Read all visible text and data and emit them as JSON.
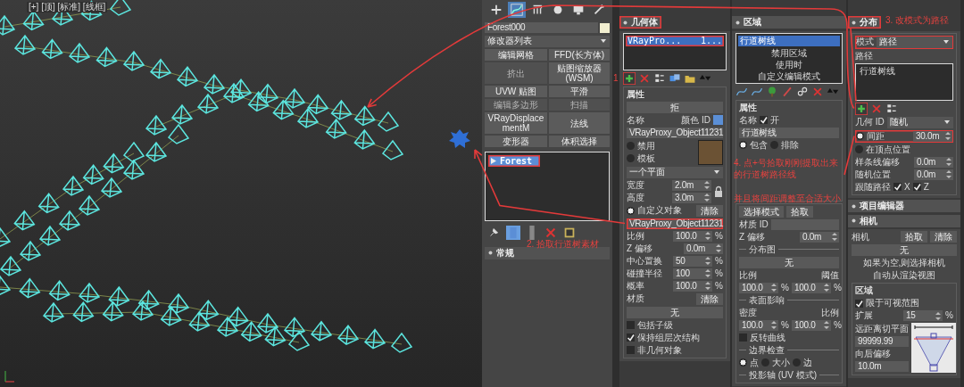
{
  "viewport": {
    "label": "[+] [顶] [标准] [线框]"
  },
  "command_panel": {
    "tabs": [
      {
        "kind": "create",
        "selected": false
      },
      {
        "kind": "modify",
        "selected": true
      },
      {
        "kind": "hierarchy",
        "selected": false
      },
      {
        "kind": "motion",
        "selected": false
      },
      {
        "kind": "display",
        "selected": false
      },
      {
        "kind": "utilities",
        "selected": false
      }
    ],
    "object_name": "Forest000",
    "modifier_list": "修改器列表",
    "modifier_buttons": [
      {
        "label": "编辑网格",
        "disabled": false
      },
      {
        "label": "FFD(长方体)",
        "disabled": false
      },
      {
        "label": "挤出",
        "disabled": true
      },
      {
        "label": "贴图缩放器 (WSM)",
        "disabled": false
      },
      {
        "label": "UVW 贴图",
        "disabled": false
      },
      {
        "label": "平滑",
        "disabled": false
      },
      {
        "label": "编辑多边形",
        "disabled": true
      },
      {
        "label": "扫描",
        "disabled": true
      },
      {
        "label": "VRayDisplacementM",
        "disabled": false
      },
      {
        "label": "法线",
        "disabled": false
      },
      {
        "label": "变形器",
        "disabled": false
      },
      {
        "label": "体积选择",
        "disabled": false
      }
    ],
    "stack": [
      {
        "label": "Forest",
        "selected": true,
        "highlighted": true
      }
    ],
    "stack_tools": [
      {
        "kind": "pin",
        "selected": false
      },
      {
        "kind": "show-result",
        "selected": true
      },
      {
        "kind": "unique",
        "selected": false
      },
      {
        "kind": "remove",
        "selected": false
      },
      {
        "kind": "configure",
        "selected": false
      }
    ],
    "rollouts": [
      {
        "title": "常规"
      }
    ]
  },
  "panels": [
    {
      "rollouts": [
        {
          "title": "几何体",
          "highlighted": true,
          "sections": [
            {
              "boxed": false,
              "rows": [
                {
                  "items": [
                    {
                      "kind": "list",
                      "items": [
                        {
                          "label": "VRayPro...",
                          "detail": "1...",
                          "selected": true,
                          "highlighted": true
                        }
                      ]
                    }
                  ]
                },
                {
                  "items": [
                    {
                      "kind": "toolbar",
                      "icons": [
                        {
                          "kind": "add",
                          "highlighted": true
                        },
                        {
                          "kind": "remove",
                          "highlighted": false
                        },
                        {
                          "kind": "list",
                          "highlighted": false
                        },
                        {
                          "kind": "copy",
                          "highlighted": false
                        },
                        {
                          "kind": "folder",
                          "highlighted": false
                        },
                        {
                          "kind": "arrows",
                          "highlighted": false
                        }
                      ]
                    }
                  ]
                }
              ]
            },
            {
              "boxed": true,
              "title": "属性",
              "rows": [
                {
                  "items": [
                    {
                      "kind": "btn",
                      "text": "拒"
                    }
                  ]
                },
                {
                  "items": [
                    {
                      "kind": "text",
                      "text": "名称"
                    },
                    {
                      "kind": "text",
                      "text": "颜色 ID"
                    },
                    {
                      "kind": "swatch",
                      "color": "#5b8fd6"
                    }
                  ]
                },
                {
                  "items": [
                    {
                      "kind": "field",
                      "value": "VRayProxy_Object11231"
                    }
                  ]
                },
                {
                  "items": [
                    {
                      "kind": "col",
                      "rows": [
                        {
                          "items": [
                            {
                              "kind": "radio",
                              "text": "禁用",
                              "selected": false
                            }
                          ]
                        },
                        {
                          "items": [
                            {
                              "kind": "radio",
                              "text": "模板",
                              "selected": false
                            }
                          ]
                        }
                      ]
                    },
                    {
                      "kind": "thumb"
                    }
                  ]
                },
                {
                  "items": [
                    {
                      "kind": "dropdown",
                      "value": "一个平面"
                    }
                  ]
                },
                {
                  "items": [
                    {
                      "kind": "col",
                      "rows": [
                        {
                          "items": [
                            {
                              "kind": "text",
                              "text": "宽度"
                            },
                            {
                              "kind": "spin",
                              "value": "2.0m"
                            }
                          ]
                        },
                        {
                          "items": [
                            {
                              "kind": "text",
                              "text": "高度"
                            },
                            {
                              "kind": "spin",
                              "value": "3.0m"
                            }
                          ]
                        }
                      ]
                    },
                    {
                      "kind": "lock"
                    }
                  ]
                },
                {
                  "items": [
                    {
                      "kind": "radio",
                      "text": "自定义对象",
                      "selected": true
                    },
                    {
                      "kind": "btn",
                      "text": "清除"
                    }
                  ]
                },
                {
                  "items": [
                    {
                      "kind": "field",
                      "value": "VRayProxy_Object11231",
                      "highlighted": true
                    }
                  ]
                },
                {
                  "items": [
                    {
                      "kind": "text",
                      "text": "比例"
                    },
                    {
                      "kind": "spin",
                      "value": "100.0"
                    },
                    {
                      "kind": "text",
                      "text": "%"
                    }
                  ]
                },
                {
                  "items": [
                    {
                      "kind": "text",
                      "text": "Z 偏移"
                    },
                    {
                      "kind": "spin",
                      "value": "0.0m"
                    }
                  ]
                },
                {
                  "items": [
                    {
                      "kind": "text",
                      "text": "中心置换"
                    },
                    {
                      "kind": "spin",
                      "value": "50"
                    },
                    {
                      "kind": "text",
                      "text": "%"
                    }
                  ]
                },
                {
                  "items": [
                    {
                      "kind": "text",
                      "text": "碰撞半径"
                    },
                    {
                      "kind": "spin",
                      "value": "100"
                    },
                    {
                      "kind": "text",
                      "text": "%"
                    }
                  ]
                },
                {
                  "items": [
                    {
                      "kind": "text",
                      "text": "概率"
                    },
                    {
                      "kind": "spin",
                      "value": "100.0"
                    },
                    {
                      "kind": "text",
                      "text": "%"
                    }
                  ]
                },
                {
                  "items": [
                    {
                      "kind": "text",
                      "text": "材质"
                    },
                    {
                      "kind": "btn",
                      "text": "清除"
                    }
                  ]
                },
                {
                  "items": [
                    {
                      "kind": "btn",
                      "text": "无"
                    }
                  ]
                },
                {
                  "items": [
                    {
                      "kind": "check",
                      "text": "包括子级",
                      "checked": false
                    }
                  ]
                },
                {
                  "items": [
                    {
                      "kind": "check",
                      "text": "保持组层次结构",
                      "checked": true
                    }
                  ]
                },
                {
                  "items": [
                    {
                      "kind": "check",
                      "text": "非几何对象",
                      "checked": false
                    }
                  ]
                }
              ]
            }
          ]
        }
      ]
    },
    {
      "rollouts": [
        {
          "title": "区域",
          "highlighted": false,
          "sections": [
            {
              "boxed": false,
              "rows": [
                {
                  "items": [
                    {
                      "kind": "list",
                      "items": [
                        {
                          "label": "行道树线",
                          "selected": true,
                          "highlighted": false
                        }
                      ],
                      "note": [
                        "禁用区域",
                        "使用时",
                        "自定义编辑模式"
                      ]
                    }
                  ]
                },
                {
                  "items": [
                    {
                      "kind": "toolbar",
                      "icons": [
                        {
                          "kind": "spline",
                          "highlighted": false
                        },
                        {
                          "kind": "spline",
                          "highlighted": false
                        },
                        {
                          "kind": "tree",
                          "highlighted": false
                        },
                        {
                          "kind": "brush",
                          "highlighted": false
                        },
                        {
                          "kind": "link",
                          "highlighted": false
                        },
                        {
                          "kind": "remove",
                          "highlighted": false
                        },
                        {
                          "kind": "arrows",
                          "highlighted": false
                        }
                      ]
                    }
                  ]
                }
              ]
            },
            {
              "boxed": true,
              "title": "属性",
              "tall": true,
              "rows": [
                {
                  "items": [
                    {
                      "kind": "text",
                      "text": "名称"
                    },
                    {
                      "kind": "check",
                      "text": "开",
                      "checked": true
                    }
                  ]
                },
                {
                  "items": [
                    {
                      "kind": "field",
                      "value": "行道树线"
                    }
                  ]
                },
                {
                  "items": [
                    {
                      "kind": "radio",
                      "text": "包含",
                      "selected": true
                    },
                    {
                      "kind": "radio",
                      "text": "排除",
                      "selected": false
                    }
                  ]
                }
              ]
            },
            {
              "boxed": true,
              "rows": [
                {
                  "items": [
                    {
                      "kind": "btn",
                      "text": "选择模式"
                    },
                    {
                      "kind": "btn",
                      "text": "拾取"
                    }
                  ]
                },
                {
                  "items": [
                    {
                      "kind": "text",
                      "text": "材质 ID"
                    },
                    {
                      "kind": "field"
                    }
                  ]
                },
                {
                  "items": [
                    {
                      "kind": "text",
                      "text": "Z 偏移"
                    },
                    {
                      "kind": "spin",
                      "value": "0.0m"
                    }
                  ]
                },
                {
                  "items": [
                    {
                      "kind": "group",
                      "text": "分布图"
                    }
                  ]
                },
                {
                  "items": [
                    {
                      "kind": "btn",
                      "text": "无"
                    }
                  ]
                },
                {
                  "items": [
                    {
                      "kind": "text",
                      "text": "比例"
                    },
                    {
                      "kind": "text",
                      "text": "阈值"
                    }
                  ]
                },
                {
                  "items": [
                    {
                      "kind": "spin",
                      "value": "100.0"
                    },
                    {
                      "kind": "text",
                      "text": "%"
                    },
                    {
                      "kind": "spin",
                      "value": "100.0"
                    },
                    {
                      "kind": "text",
                      "text": "%"
                    }
                  ]
                },
                {
                  "items": [
                    {
                      "kind": "group",
                      "text": "表面影响"
                    }
                  ]
                },
                {
                  "items": [
                    {
                      "kind": "text",
                      "text": "密度"
                    },
                    {
                      "kind": "text",
                      "text": "比例"
                    }
                  ]
                },
                {
                  "items": [
                    {
                      "kind": "spin",
                      "value": "100.0"
                    },
                    {
                      "kind": "text",
                      "text": "%"
                    },
                    {
                      "kind": "spin",
                      "value": "100.0"
                    },
                    {
                      "kind": "text",
                      "text": "%"
                    }
                  ]
                },
                {
                  "items": [
                    {
                      "kind": "check",
                      "text": "反转曲线",
                      "checked": false
                    }
                  ]
                },
                {
                  "items": [
                    {
                      "kind": "group",
                      "text": "边界检查"
                    }
                  ]
                },
                {
                  "items": [
                    {
                      "kind": "radio",
                      "text": "点",
                      "selected": true
                    },
                    {
                      "kind": "radio",
                      "text": "大小",
                      "selected": false
                    },
                    {
                      "kind": "radio",
                      "text": "边",
                      "selected": false
                    }
                  ]
                },
                {
                  "items": [
                    {
                      "kind": "group",
                      "text": "投影轴 (UV 模式)"
                    }
                  ]
                }
              ]
            }
          ]
        }
      ]
    },
    {
      "rollouts": [
        {
          "title": "分布",
          "highlighted": true,
          "sections": [
            {
              "boxed": true,
              "rows": [
                {
                  "highlighted": true,
                  "items": [
                    {
                      "kind": "text",
                      "text": "模式"
                    },
                    {
                      "kind": "dropdown",
                      "value": "路径"
                    }
                  ]
                },
                {
                  "items": [
                    {
                      "kind": "text",
                      "text": "路径"
                    }
                  ]
                },
                {
                  "items": [
                    {
                      "kind": "list",
                      "items": [
                        {
                          "label": "行道树线",
                          "selected": false,
                          "highlighted": false
                        }
                      ]
                    }
                  ]
                },
                {
                  "items": [
                    {
                      "kind": "toolbar",
                      "icons": [
                        {
                          "kind": "add",
                          "highlighted": true
                        },
                        {
                          "kind": "remove",
                          "highlighted": false
                        },
                        {
                          "kind": "list",
                          "highlighted": false
                        }
                      ]
                    }
                  ]
                },
                {
                  "items": [
                    {
                      "kind": "text",
                      "text": "几何 ID"
                    },
                    {
                      "kind": "dropdown",
                      "value": "随机"
                    }
                  ]
                },
                {
                  "highlighted": true,
                  "items": [
                    {
                      "kind": "radio",
                      "text": "间距",
                      "selected": true
                    },
                    {
                      "kind": "spin",
                      "value": "30.0m"
                    }
                  ]
                },
                {
                  "items": [
                    {
                      "kind": "radio",
                      "text": "在顶点位置",
                      "selected": false
                    }
                  ]
                },
                {
                  "items": [
                    {
                      "kind": "text",
                      "text": "样条线偏移"
                    },
                    {
                      "kind": "spin",
                      "value": "0.0m"
                    }
                  ]
                },
                {
                  "items": [
                    {
                      "kind": "text",
                      "text": "随机位置"
                    },
                    {
                      "kind": "spin",
                      "value": "0.0m"
                    }
                  ]
                },
                {
                  "items": [
                    {
                      "kind": "text",
                      "text": "跟随路径"
                    },
                    {
                      "kind": "check",
                      "text": "X",
                      "checked": true
                    },
                    {
                      "kind": "check",
                      "text": "Z",
                      "checked": true
                    }
                  ]
                }
              ]
            }
          ]
        },
        {
          "title": "项目编辑器",
          "highlighted": false
        },
        {
          "title": "相机",
          "highlighted": false,
          "sections": [
            {
              "boxed": false,
              "rows": [
                {
                  "items": [
                    {
                      "kind": "text",
                      "text": "相机"
                    },
                    {
                      "kind": "btn",
                      "text": "拾取"
                    },
                    {
                      "kind": "btn",
                      "text": "清除"
                    }
                  ]
                },
                {
                  "items": [
                    {
                      "kind": "btn",
                      "text": "无"
                    }
                  ]
                },
                {
                  "items": [
                    {
                      "kind": "text",
                      "text": "如果为空,则选择相机",
                      "center": true
                    }
                  ]
                },
                {
                  "items": [
                    {
                      "kind": "text",
                      "text": "自动从渲染视图",
                      "center": true
                    }
                  ]
                }
              ]
            },
            {
              "boxed": true,
              "title": "区域",
              "rows": [
                {
                  "items": [
                    {
                      "kind": "check",
                      "text": "限于可视范围",
                      "checked": true
                    }
                  ]
                },
                {
                  "items": [
                    {
                      "kind": "text",
                      "text": "扩展"
                    },
                    {
                      "kind": "spin",
                      "value": "15"
                    },
                    {
                      "kind": "text",
                      "text": "%"
                    }
                  ]
                },
                {
                  "items": [
                    {
                      "kind": "col",
                      "rows": [
                        {
                          "items": [
                            {
                              "kind": "text",
                              "text": "远距离切平面"
                            }
                          ]
                        },
                        {
                          "items": [
                            {
                              "kind": "field",
                              "value": "99999.99"
                            }
                          ]
                        },
                        {
                          "items": [
                            {
                              "kind": "text",
                              "text": "向后偏移"
                            }
                          ]
                        },
                        {
                          "items": [
                            {
                              "kind": "field",
                              "value": "10.0m"
                            }
                          ]
                        }
                      ]
                    },
                    {
                      "kind": "frustum"
                    }
                  ]
                }
              ]
            }
          ]
        }
      ]
    }
  ],
  "annotations": [
    {
      "text": "1"
    },
    {
      "text": "2. 拾取行道树素材"
    },
    {
      "text": "3. 改模式为路径"
    },
    {
      "text": "4. 点+号拾取刚刚提取出来的行道树路径线"
    },
    {
      "text": "并且将间距调整至合适大小"
    }
  ]
}
